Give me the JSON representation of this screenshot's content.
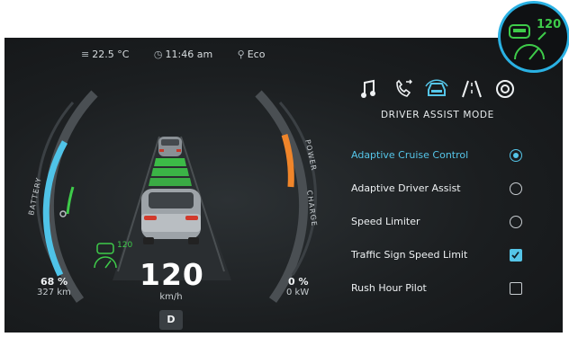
{
  "status": {
    "temperature": "22.5 °C",
    "time": "11:46 am",
    "drive_mode": "Eco"
  },
  "battery": {
    "label": "BATTERY",
    "percent": "68 %",
    "range": "327 km",
    "level": 0.68
  },
  "power": {
    "label": "POWER",
    "charge_label": "CHARGE",
    "percent": "0 %",
    "kw": "0 kW"
  },
  "speed": {
    "value": "120",
    "unit": "km/h",
    "limit_sign": "120"
  },
  "gear": "D",
  "mode_icons": [
    "music-icon",
    "phone-icon",
    "driver-assist-car-icon",
    "lane-icon",
    "settings-dial-icon"
  ],
  "driver_assist": {
    "title": "DRIVER ASSIST MODE",
    "options": [
      {
        "label": "Adaptive Cruise Control",
        "control": "radio",
        "selected": true
      },
      {
        "label": "Adaptive Driver Assist",
        "control": "radio",
        "selected": false
      },
      {
        "label": "Speed Limiter",
        "control": "radio",
        "selected": false
      },
      {
        "label": "Traffic Sign Speed Limit",
        "control": "checkbox",
        "selected": true
      },
      {
        "label": "Rush Hour Pilot",
        "control": "checkbox",
        "selected": false
      }
    ]
  },
  "badge": {
    "speed": "120"
  },
  "colors": {
    "accent": "#55c5e8",
    "battery": "#4fc3e8",
    "power": "#f0852a",
    "assist_green": "#3ecb4a",
    "badge_ring": "#2ab1e3"
  }
}
